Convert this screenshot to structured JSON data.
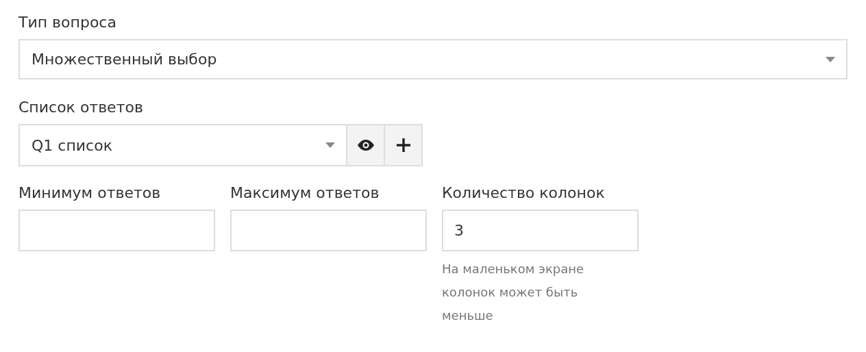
{
  "question_type": {
    "label": "Тип вопроса",
    "value": "Множественный выбор"
  },
  "answer_list": {
    "label": "Список ответов",
    "value": "Q1 список",
    "buttons": [
      {
        "kind": "view"
      },
      {
        "kind": "add"
      }
    ]
  },
  "fields": [
    {
      "label": "Минимум ответов"
    },
    {
      "label": "Максимум ответов"
    },
    {
      "label": "Количество колонок",
      "value": "3",
      "hint": "На маленьком экране колонок может быть меньше"
    }
  ]
}
